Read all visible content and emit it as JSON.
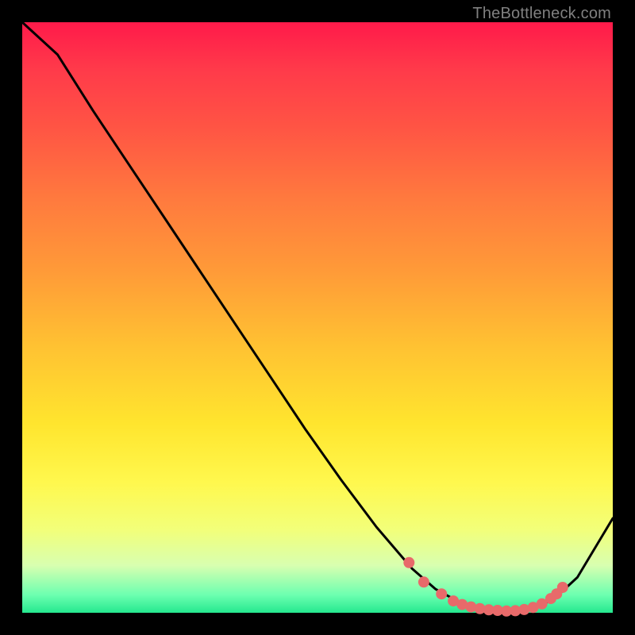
{
  "attribution": "TheBottleneck.com",
  "colors": {
    "background": "#000000",
    "gradient_top": "#ff1a4a",
    "gradient_bottom": "#25e88f",
    "curve": "#000000",
    "marker": "#e86a6a"
  },
  "chart_data": {
    "type": "line",
    "title": "",
    "xlabel": "",
    "ylabel": "",
    "xlim": [
      0,
      100
    ],
    "ylim": [
      0,
      100
    ],
    "series": [
      {
        "name": "bottleneck-curve",
        "x": [
          0,
          6,
          12,
          18,
          24,
          30,
          36,
          42,
          48,
          54,
          60,
          66,
          70,
          74,
          78,
          82,
          86,
          90,
          94,
          100
        ],
        "y": [
          100,
          94.5,
          85,
          76,
          67,
          58,
          49,
          40,
          31,
          22.5,
          14.5,
          7.5,
          4,
          1.8,
          0.6,
          0.2,
          0.5,
          2.3,
          6,
          16
        ]
      }
    ],
    "markers": {
      "name": "highlight-dots",
      "x": [
        65.5,
        68,
        71,
        73,
        74.5,
        76,
        77.5,
        79,
        80.5,
        82,
        83.5,
        85,
        86.5,
        88,
        89.5,
        90.5,
        91.5
      ],
      "y": [
        8.5,
        5.2,
        3.2,
        2.0,
        1.4,
        1.0,
        0.7,
        0.5,
        0.4,
        0.3,
        0.35,
        0.55,
        0.9,
        1.5,
        2.4,
        3.2,
        4.3
      ]
    }
  }
}
